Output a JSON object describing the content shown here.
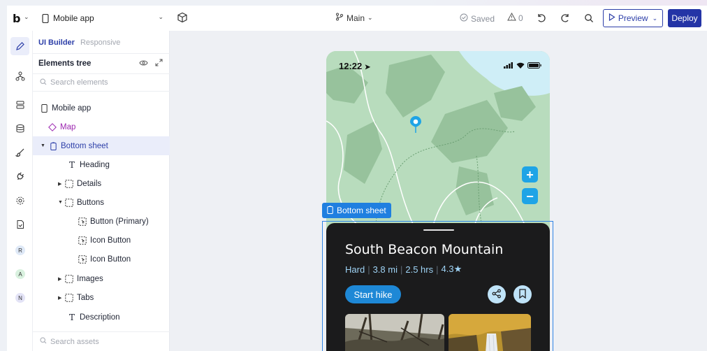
{
  "topbar": {
    "logo": "b",
    "app_selector": "Mobile app",
    "branch": "Main",
    "saved": "Saved",
    "warning_count": "0",
    "preview": "Preview",
    "deploy": "Deploy"
  },
  "rail": {
    "avatars": [
      "R",
      "A",
      "N"
    ]
  },
  "panel": {
    "tabs": [
      "UI Builder",
      "Responsive"
    ],
    "tree_title": "Elements tree",
    "search_placeholder": "Search elements",
    "assets_placeholder": "Search assets",
    "tree": [
      {
        "label": "Mobile app",
        "icon": "phone-icon"
      },
      {
        "label": "Map",
        "icon": "diamond-icon"
      },
      {
        "label": "Bottom sheet",
        "icon": "sheet-icon",
        "selected": true
      },
      {
        "label": "Heading",
        "icon": "text-icon"
      },
      {
        "label": "Details",
        "icon": "container-icon"
      },
      {
        "label": "Buttons",
        "icon": "container-icon"
      },
      {
        "label": "Button (Primary)",
        "icon": "button-icon"
      },
      {
        "label": "Icon Button",
        "icon": "button-icon"
      },
      {
        "label": "Icon Button",
        "icon": "button-icon"
      },
      {
        "label": "Images",
        "icon": "container-icon"
      },
      {
        "label": "Tabs",
        "icon": "container-icon"
      },
      {
        "label": "Description",
        "icon": "text-icon"
      }
    ]
  },
  "canvas": {
    "selection_label": "Bottom sheet",
    "phone": {
      "time": "12:22",
      "sheet": {
        "title": "South Beacon Mountain",
        "difficulty": "Hard",
        "distance": "3.8 mi",
        "duration": "2.5 hrs",
        "rating": "4.3★",
        "start_button": "Start hike"
      }
    }
  },
  "colors": {
    "accent": "#2434a6",
    "selection": "#1f7fe0",
    "map_green": "#b6dcbc",
    "sheet_bg": "#1b1b1c",
    "pin": "#1ea4e6"
  }
}
